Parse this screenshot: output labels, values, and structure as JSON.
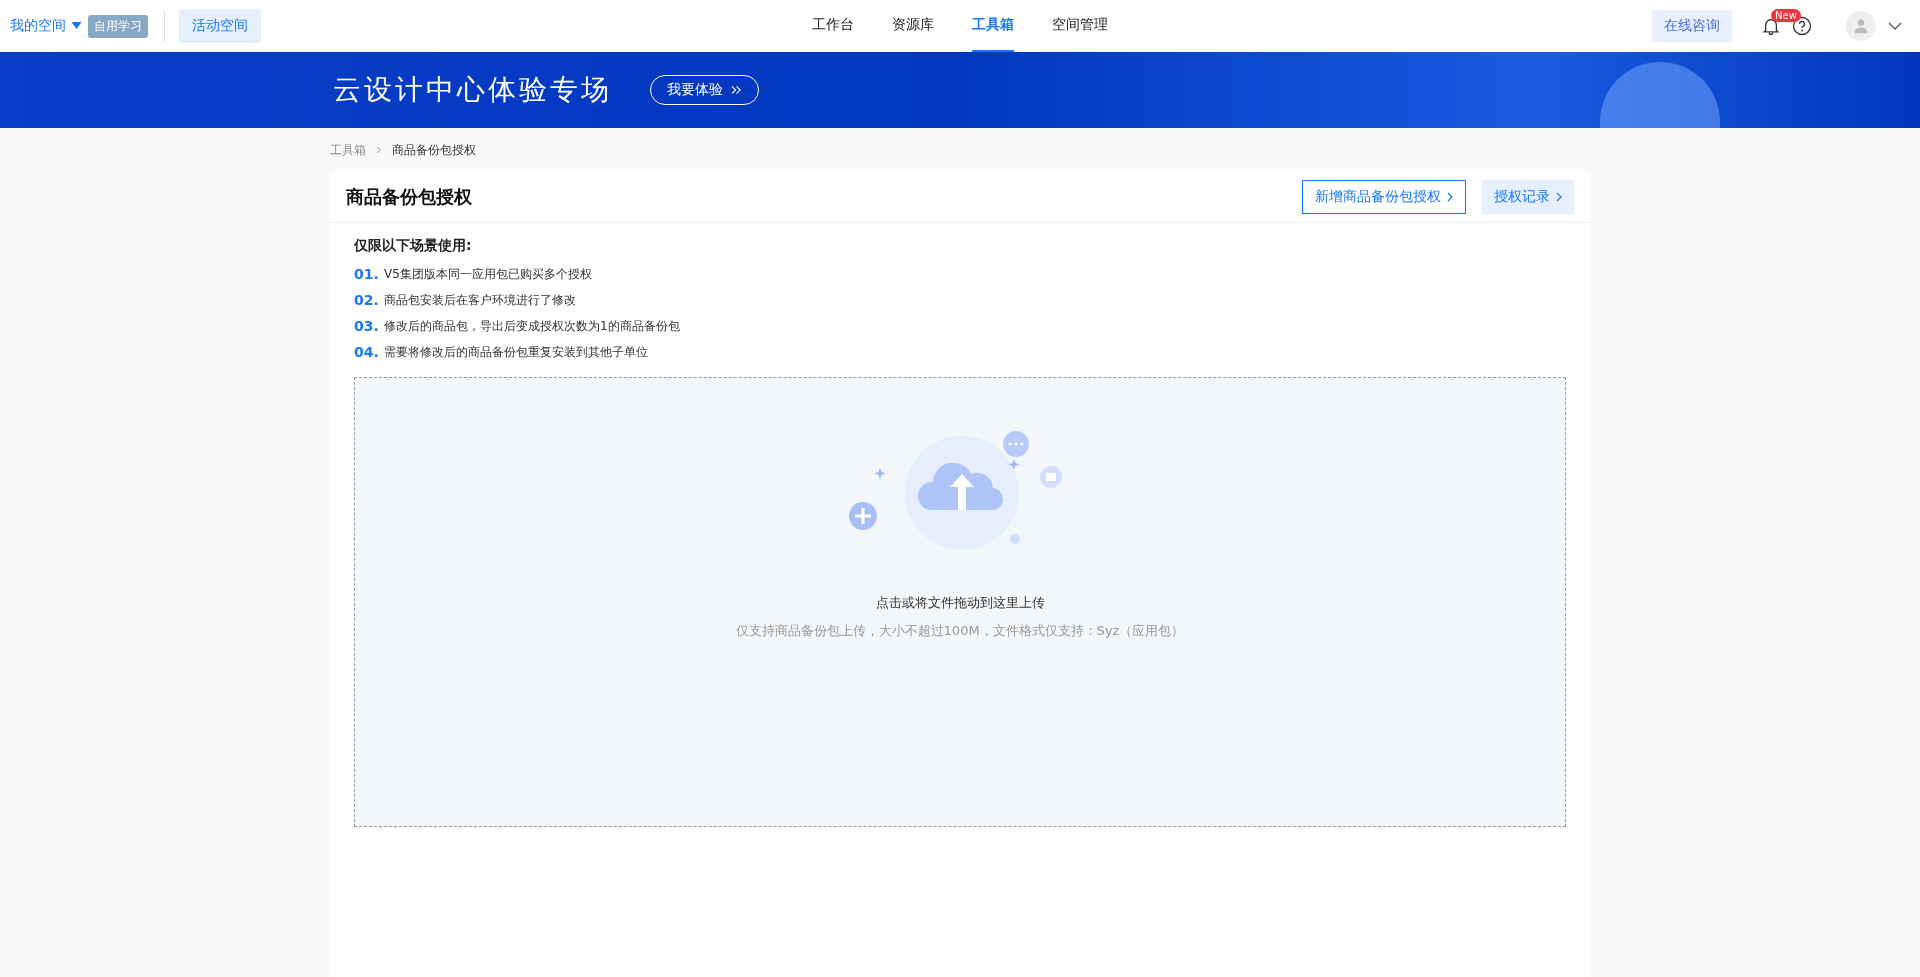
{
  "topbar": {
    "space_switcher": "我的空间",
    "space_tag": "自用学习",
    "activity_button": "活动空间",
    "nav": [
      {
        "label": "工作台",
        "selected": false
      },
      {
        "label": "资源库",
        "selected": false
      },
      {
        "label": "工具箱",
        "selected": true
      },
      {
        "label": "空间管理",
        "selected": false
      }
    ],
    "consult_button": "在线咨询",
    "notification_badge": "New"
  },
  "banner": {
    "title": "云设计中心体验专场",
    "button": "我要体验"
  },
  "breadcrumb": [
    "工具箱",
    "商品备份包授权"
  ],
  "page": {
    "title": "商品备份包授权",
    "actions": [
      {
        "label": "新增商品备份包授权",
        "kind": "outline"
      },
      {
        "label": "授权记录",
        "kind": "light"
      }
    ],
    "notice_heading": "仅限以下场景使用:",
    "conditions": [
      {
        "number": "01.",
        "text": "V5集团版本同一应用包已购买多个授权"
      },
      {
        "number": "02.",
        "text": "商品包安装后在客户环境进行了修改"
      },
      {
        "number": "03.",
        "text": "修改后的商品包，导出后变成授权次数为1的商品备份包"
      },
      {
        "number": "04.",
        "text": "需要将修改后的商品备份包重复安装到其他子单位"
      }
    ],
    "upload": {
      "prompt": "点击或将文件拖动到这里上传",
      "hint": "仅支持商品备份包上传，大小不超过100M，文件格式仅支持：Syz（应用包）"
    }
  }
}
